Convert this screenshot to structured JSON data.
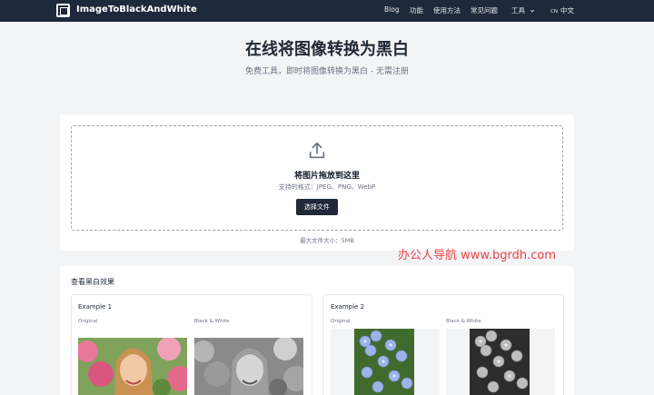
{
  "header": {
    "brand": "ImageToBlackAndWhite",
    "nav": {
      "blog": "Blog",
      "features": "功能",
      "usage": "使用方法",
      "faq": "常见问题",
      "tools": "工具",
      "lang_flag": "CN",
      "lang": "中文"
    }
  },
  "hero": {
    "title": "在线将图像转换为黑白",
    "subtitle": "免费工具，即时将图像转换为黑白 - 无需注册"
  },
  "upload": {
    "drop_title": "将图片拖放到这里",
    "formats": "支持的格式：JPEG、PNG、WebP",
    "button": "选择文件",
    "max_size": "最大文件大小：5MB"
  },
  "watermark": "办公人导航  www.bgrdh.com",
  "examples": {
    "heading": "查看黑白效果",
    "items": [
      {
        "title": "Example 1",
        "original_label": "Original",
        "bw_label": "Black & White"
      },
      {
        "title": "Example 2",
        "original_label": "Original",
        "bw_label": "Black & White"
      }
    ]
  },
  "colors": {
    "header_bg": "#1e293b",
    "page_bg": "#f3f4f6",
    "button_bg": "#1f2937",
    "watermark": "#ef4444"
  },
  "icons": [
    "logo-icon",
    "chevron-down-icon",
    "upload-icon"
  ]
}
